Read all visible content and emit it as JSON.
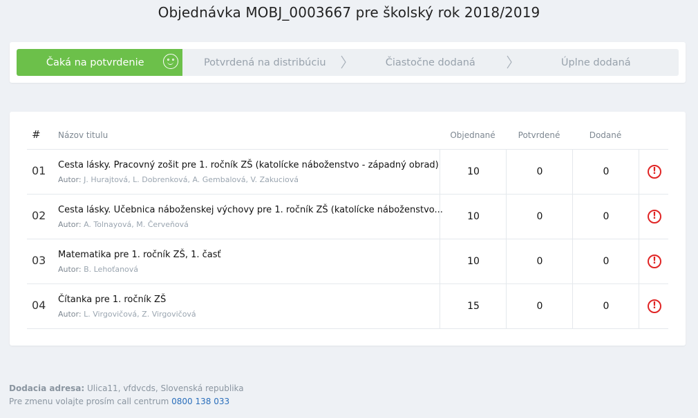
{
  "page": {
    "title": "Objednávka MOBJ_0003667 pre školský rok 2018/2019"
  },
  "steps": [
    {
      "label": "Čaká na potvrdenie",
      "active": true
    },
    {
      "label": "Potvrdená na distribúciu",
      "active": false
    },
    {
      "label": "Čiastočne dodaná",
      "active": false
    },
    {
      "label": "Úplne dodaná",
      "active": false
    }
  ],
  "table": {
    "headers": {
      "num": "#",
      "name": "Názov titulu",
      "ordered": "Objednané",
      "confirmed": "Potvrdené",
      "delivered": "Dodané"
    },
    "author_label": "Autor:",
    "rows": [
      {
        "num": "01",
        "title": "Cesta lásky. Pracovný zošit pre 1. ročník ZŠ (katolícke náboženstvo - západný obrad)",
        "authors": "J. Hurajtová, L. Dobrenková, A. Gembalová, V. Zakuciová",
        "ordered": "10",
        "confirmed": "0",
        "delivered": "0"
      },
      {
        "num": "02",
        "title": "Cesta lásky. Učebnica náboženskej výchovy pre 1. ročník ZŠ (katolícke náboženstvo...",
        "authors": "A. Tolnayová, M. Červeňová",
        "ordered": "10",
        "confirmed": "0",
        "delivered": "0"
      },
      {
        "num": "03",
        "title": "Matematika pre 1. ročník ZŠ, 1. časť",
        "authors": "B. Lehoťanová",
        "ordered": "10",
        "confirmed": "0",
        "delivered": "0"
      },
      {
        "num": "04",
        "title": "Čítanka pre 1. ročník ZŠ",
        "authors": "L. Virgovičová, Z. Virgovičová",
        "ordered": "15",
        "confirmed": "0",
        "delivered": "0"
      }
    ]
  },
  "footer": {
    "address_label": "Dodacia adresa:",
    "address": "Ulica11, vfdvcds, Slovenská republika",
    "call_text": "Pre zmenu volajte prosím call centrum",
    "phone": "0800 138 033"
  },
  "colors": {
    "accent": "#6cc04a",
    "warning": "#e02424",
    "link": "#2a6ebb"
  }
}
